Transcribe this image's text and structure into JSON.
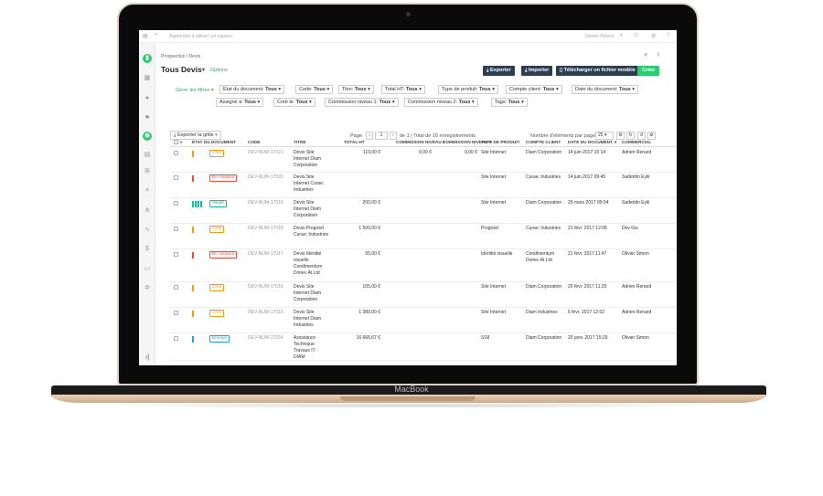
{
  "topbar": {
    "search_placeholder": "Apprendre à utiliser cet espace",
    "user": "Génier Binson"
  },
  "breadcrumb": "Prospection / Devis",
  "page_title": "Tous Devis",
  "options_label": "Options",
  "actions": {
    "export": "Exporter",
    "import": "Importer",
    "download_model": "Télécharger un fichier modèle",
    "create": "Créer"
  },
  "filters_label": "Gérer les filtres",
  "filters": [
    {
      "name": "État du document:",
      "value": "Tous"
    },
    {
      "name": "Code:",
      "value": "Tous"
    },
    {
      "name": "Titre:",
      "value": "Tous"
    },
    {
      "name": "Total HT:",
      "value": "Tous"
    },
    {
      "name": "Type de produit:",
      "value": "Tous"
    },
    {
      "name": "Compte client:",
      "value": "Tous"
    },
    {
      "name": "Date du document:",
      "value": "Tous"
    },
    {
      "name": "Assigné à:",
      "value": "Tous"
    },
    {
      "name": "Créé le:",
      "value": "Tous"
    },
    {
      "name": "Commission niveau 1:",
      "value": "Tous"
    },
    {
      "name": "Commission niveau 2:",
      "value": "Tous"
    },
    {
      "name": "Tags:",
      "value": "Tous"
    }
  ],
  "grid_export": "Exporter la grille",
  "pagination": {
    "page_label": "Page:",
    "page": "1",
    "of_text": "de 1 | Total de 16 enregistrements",
    "per_page_label": "Nombre d'éléments par page:",
    "per_page": "25"
  },
  "columns": [
    "ÉTAT DU DOCUMENT",
    "CODE",
    "TITRE",
    "TOTAL HT",
    "COMMISSION NIVEAU 1",
    "COMMISSION NIVEAU 2",
    "TYPE DE PRODUIT",
    "COMPTE CLIENT",
    "DATE DU DOCUMENT",
    "COMMERCIAL"
  ],
  "rows": [
    {
      "status": "Créé",
      "status_color": "#f39c12",
      "code": "DEV-NUM-17021",
      "title": "Devis Site Internet Diam Corporation",
      "total": "119,00 €",
      "com1": "0,00 €",
      "com2": "0,00 €",
      "type": "Site Internet",
      "client": "Diam Corporation",
      "date": "14 juin 2017 15:14",
      "commercial": "Adrien Renard"
    },
    {
      "status": "En création",
      "status_color": "#e74c3c",
      "code": "DEV-NUM-17020",
      "title": "Devis Site Internet Curae; Industries",
      "total": "",
      "com1": "",
      "com2": "",
      "type": "Site Internet",
      "client": "Curae; Industries",
      "date": "14 juin 2017 09:45",
      "commercial": "Sadetdin Eyili"
    },
    {
      "status": "Validé",
      "status_color": "#1abc9c",
      "code": "DEV-NUM-17019",
      "title": "Devis Site Internet Diam Corporation",
      "total": "200,00 €",
      "com1": "",
      "com2": "",
      "type": "Site Internet",
      "client": "Diam Corporation",
      "date": "29 mars 2017 09:04",
      "commercial": "Sadetdin Eyili"
    },
    {
      "status": "Créé",
      "status_color": "#f39c12",
      "code": "DEV-NUM-17018",
      "title": "Devis Progiciel Curae; Industries",
      "total": "1 500,00 €",
      "com1": "",
      "com2": "",
      "type": "Progiciel",
      "client": "Curae; Industries",
      "date": "21 févr. 2017 12:08",
      "commercial": "Dev Gw"
    },
    {
      "status": "En création",
      "status_color": "#e74c3c",
      "code": "DEV-NUM-17017",
      "title": "Devis Identité visuelle Condimentum Donec At Ltd",
      "total": "55,00 €",
      "com1": "",
      "com2": "",
      "type": "Identité visuelle",
      "client": "Condimentum Donec At Ltd",
      "date": "21 févr. 2017 11:47",
      "commercial": "Olivier Simon"
    },
    {
      "status": "Créé",
      "status_color": "#f39c12",
      "code": "DEV-NUM-17016",
      "title": "Devis Site Internet Diam Corporation",
      "total": "105,00 €",
      "com1": "",
      "com2": "",
      "type": "Site Internet",
      "client": "Diam Corporation",
      "date": "20 févr. 2017 11:20",
      "commercial": "Adrien Renard"
    },
    {
      "status": "Créé",
      "status_color": "#f39c12",
      "code": "DEV-NUM-17015",
      "title": "Devis Site Internet Diam Industries",
      "total": "1 380,00 €",
      "com1": "",
      "com2": "",
      "type": "Site Internet",
      "client": "Diam Industries",
      "date": "6 févr. 2017 12:02",
      "commercial": "Adrien Renard"
    },
    {
      "status": "Envoyé",
      "status_color": "#3498db",
      "code": "DEV-NUM-17014",
      "title": "Assistance Technique Travaux IT - DIAM",
      "total": "16 666,67 €",
      "com1": "",
      "com2": "",
      "type": "SSII",
      "client": "Diam Corporation",
      "date": "20 janv. 2017 15:29",
      "commercial": "Olivier Simon"
    }
  ],
  "laptop_brand": "MacBook"
}
